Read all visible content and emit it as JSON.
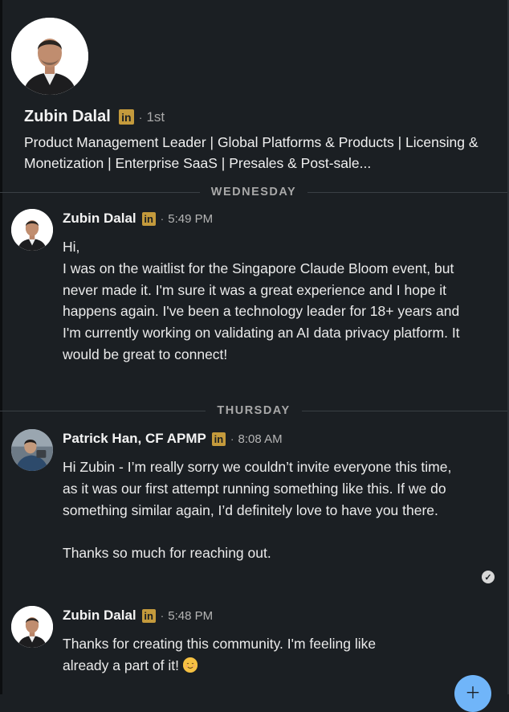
{
  "profile": {
    "name": "Zubin Dalal",
    "linkedin_badge": "in",
    "degree": "1st",
    "headline": "Product Management Leader | Global Platforms & Products | Licensing & Monetization | Enterprise SaaS | Presales & Post-sale..."
  },
  "dividers": [
    "WEDNESDAY",
    "THURSDAY"
  ],
  "messages": [
    {
      "sender": "Zubin Dalal",
      "time": "5:49 PM",
      "lines": [
        "Hi,",
        "I was on the waitlist for the Singapore Claude Bloom event, but never made it. I'm sure it was a great experience and I hope it happens again. I've been a technology leader for 18+ years and I'm currently working on validating an AI data privacy platform. It would be great to connect!"
      ]
    },
    {
      "sender": "Patrick Han, CF APMP",
      "time": "8:08 AM",
      "lines": [
        "Hi Zubin - I’m really sorry we couldn’t invite everyone this time, as it was our first attempt running something like this. If we do something similar again, I’d definitely love to have you there.",
        "Thanks so much for reaching out."
      ]
    },
    {
      "sender": "Zubin Dalal",
      "time": "5:48 PM",
      "lines": [
        "Thanks for creating this community. I'm feeling like already a part of it!"
      ]
    }
  ],
  "separator_dot": "·",
  "read_receipt_icon": "check-circle-icon",
  "compose_button_icon": "plus-icon",
  "colors": {
    "background": "#1b1f23",
    "linkedin_badge": "#c49a3c",
    "fab": "#70b5f9"
  }
}
